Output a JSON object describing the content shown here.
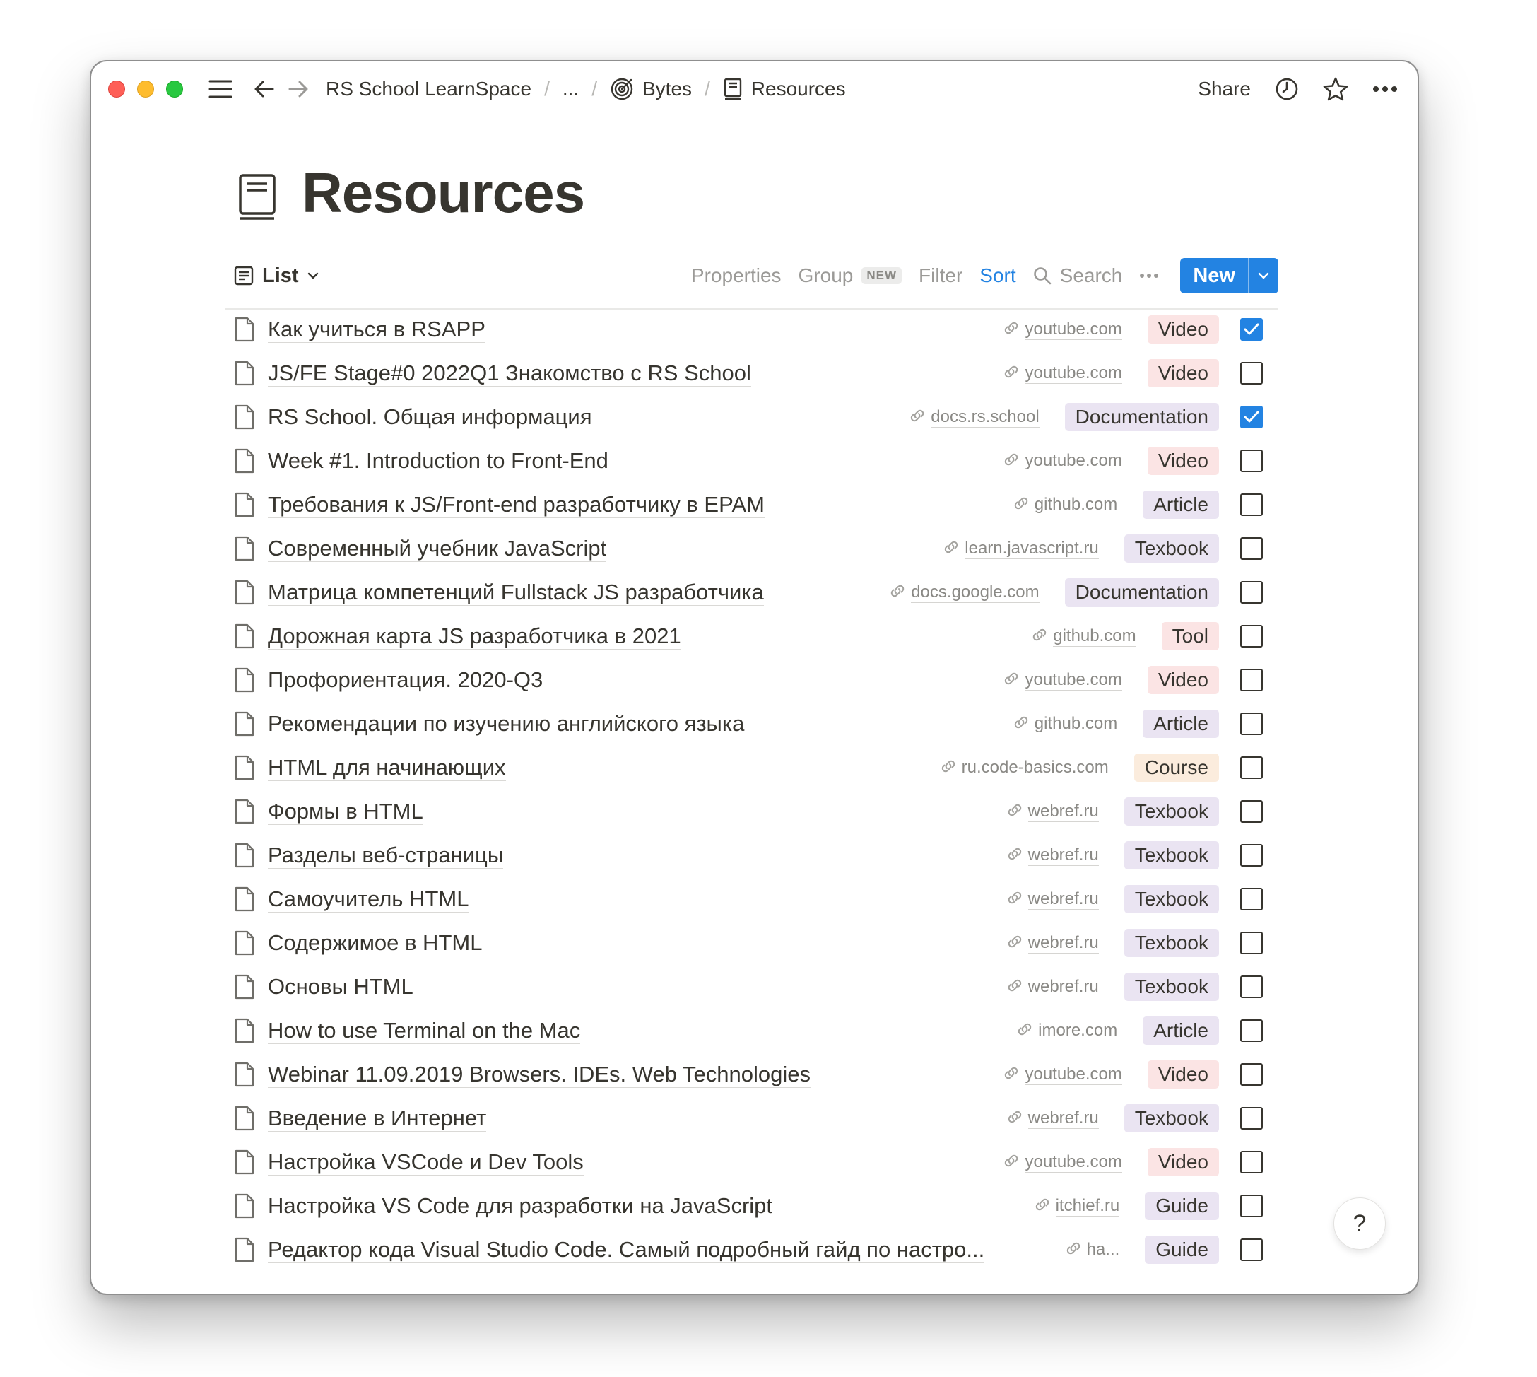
{
  "breadcrumb": {
    "workspace": "RS School LearnSpace",
    "ellipsis": "...",
    "parent": "Bytes",
    "current": "Resources",
    "separator": "/"
  },
  "header_actions": {
    "share": "Share"
  },
  "page": {
    "title": "Resources",
    "icon": "book-icon"
  },
  "toolbar": {
    "view": "List",
    "properties": "Properties",
    "group": "Group",
    "group_badge": "NEW",
    "filter": "Filter",
    "sort": "Sort",
    "search": "Search",
    "new_button": "New"
  },
  "rows": [
    {
      "title": "Как учиться в RSAPP",
      "link": "youtube.com",
      "tag": "Video",
      "tag_color": "red",
      "checked": true
    },
    {
      "title": "JS/FE Stage#0 2022Q1 Знакомство с RS School",
      "link": "youtube.com",
      "tag": "Video",
      "tag_color": "red",
      "checked": false
    },
    {
      "title": "RS School. Общая информация",
      "link": "docs.rs.school",
      "tag": "Documentation",
      "tag_color": "purple",
      "checked": true
    },
    {
      "title": "Week #1. Introduction to Front-End",
      "link": "youtube.com",
      "tag": "Video",
      "tag_color": "red",
      "checked": false
    },
    {
      "title": "Требования к JS/Front-end разработчику в EPAM",
      "link": "github.com",
      "tag": "Article",
      "tag_color": "purple",
      "checked": false
    },
    {
      "title": "Современный учебник JavaScript",
      "link": "learn.javascript.ru",
      "tag": "Texbook",
      "tag_color": "purple",
      "checked": false
    },
    {
      "title": "Матрица компетенций Fullstack JS разработчика",
      "link": "docs.google.com",
      "tag": "Documentation",
      "tag_color": "purple",
      "checked": false
    },
    {
      "title": "Дорожная карта JS разработчика в 2021",
      "link": "github.com",
      "tag": "Tool",
      "tag_color": "red",
      "checked": false
    },
    {
      "title": "Профориентация. 2020-Q3",
      "link": "youtube.com",
      "tag": "Video",
      "tag_color": "red",
      "checked": false
    },
    {
      "title": "Рекомендации по изучению английского языка",
      "link": "github.com",
      "tag": "Article",
      "tag_color": "purple",
      "checked": false
    },
    {
      "title": "HTML для начинающих",
      "link": "ru.code-basics.com",
      "tag": "Course",
      "tag_color": "orange",
      "checked": false
    },
    {
      "title": "Формы в HTML",
      "link": "webref.ru",
      "tag": "Texbook",
      "tag_color": "purple",
      "checked": false
    },
    {
      "title": "Разделы веб-страницы",
      "link": "webref.ru",
      "tag": "Texbook",
      "tag_color": "purple",
      "checked": false
    },
    {
      "title": "Самоучитель HTML",
      "link": "webref.ru",
      "tag": "Texbook",
      "tag_color": "purple",
      "checked": false
    },
    {
      "title": "Содержимое в HTML",
      "link": "webref.ru",
      "tag": "Texbook",
      "tag_color": "purple",
      "checked": false
    },
    {
      "title": "Основы HTML",
      "link": "webref.ru",
      "tag": "Texbook",
      "tag_color": "purple",
      "checked": false
    },
    {
      "title": "How to use Terminal on the Mac",
      "link": "imore.com",
      "tag": "Article",
      "tag_color": "purple",
      "checked": false
    },
    {
      "title": "Webinar 11.09.2019 Browsers. IDEs. Web Technologies",
      "link": "youtube.com",
      "tag": "Video",
      "tag_color": "red",
      "checked": false
    },
    {
      "title": "Введение в Интернет",
      "link": "webref.ru",
      "tag": "Texbook",
      "tag_color": "purple",
      "checked": false
    },
    {
      "title": "Настройка VSCode и Dev Tools",
      "link": "youtube.com",
      "tag": "Video",
      "tag_color": "red",
      "checked": false
    },
    {
      "title": "Настройка VS Code для разработки на JavaScript",
      "link": "itchief.ru",
      "tag": "Guide",
      "tag_color": "purple",
      "checked": false
    },
    {
      "title": "Редактор кода Visual Studio Code. Самый подробный гайд по настро...",
      "link": "ha...",
      "tag": "Guide",
      "tag_color": "purple",
      "checked": false
    }
  ],
  "help_button": "?",
  "colors": {
    "accent": "#2383e2",
    "text": "#37352f",
    "muted": "#9b9a97",
    "tag_red": "#fbe4e4",
    "tag_orange": "#fbecdd",
    "tag_purple": "#eae4f2"
  }
}
